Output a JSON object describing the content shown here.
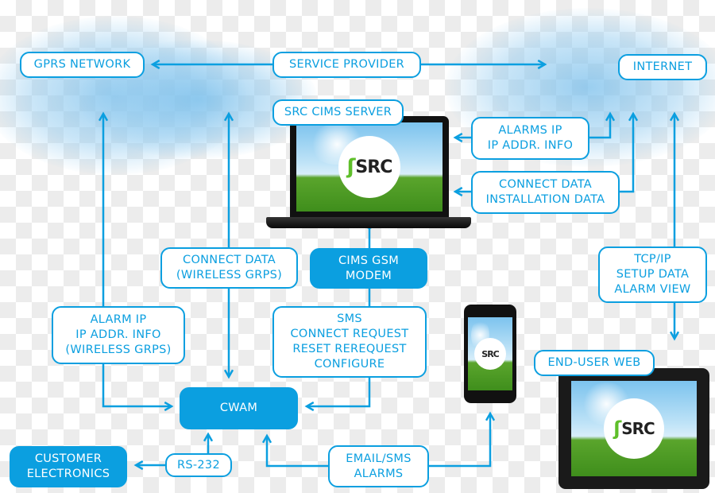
{
  "colors": {
    "accent": "#0b9fe0",
    "text_on_accent": "#ffffff"
  },
  "nodes": {
    "gprs_network": "GPRS NETWORK",
    "service_provider": "SERVICE PROVIDER",
    "internet": "INTERNET",
    "src_cims_server": "SRC CIMS SERVER",
    "alarms_ip": "ALARMS IP\nIP ADDR. INFO",
    "connect_installation": "CONNECT DATA\nINSTALLATION DATA",
    "connect_data_wireless": "CONNECT DATA\n(WIRELESS GRPS)",
    "cims_gsm_modem": "CIMS GSM\nMODEM",
    "tcp_ip": "TCP/IP\nSETUP DATA\nALARM VIEW",
    "alarm_ip": "ALARM IP\nIP ADDR. INFO\n(WIRELESS GRPS)",
    "sms": "SMS\nCONNECT REQUEST\nRESET REREQUEST\nCONFIGURE",
    "end_user_web": "END-USER WEB",
    "cwam": "CWAM",
    "customer_electronics": "CUSTOMER\nELECTRONICS",
    "rs232": "RS-232",
    "email_sms": "EMAIL/SMS\nALARMS"
  },
  "logo": {
    "text": "SRC"
  },
  "devices": [
    "laptop",
    "smartphone",
    "tablet"
  ]
}
